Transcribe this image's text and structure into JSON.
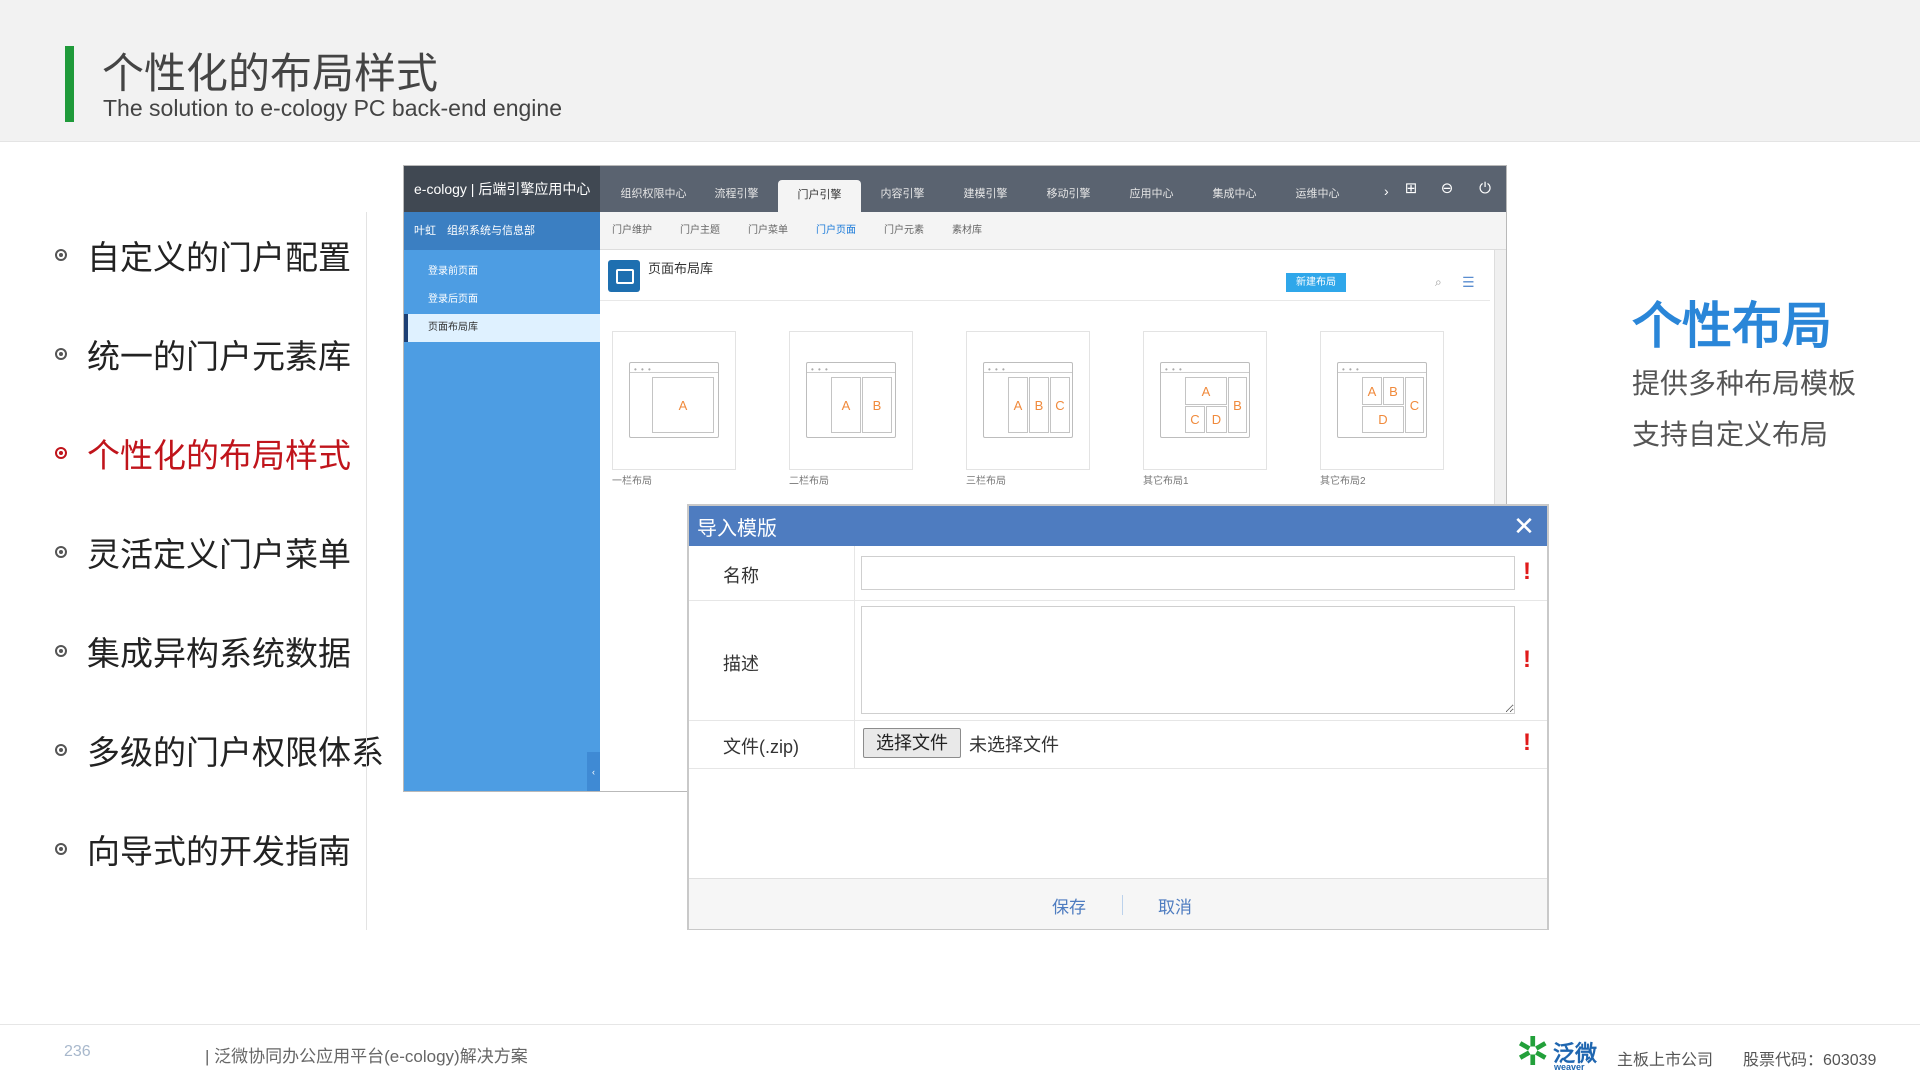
{
  "header": {
    "title": "个性化的布局样式",
    "subtitle": "The solution to e-cology PC back-end engine"
  },
  "features": [
    {
      "label": "自定义的门户配置",
      "active": false
    },
    {
      "label": "统一的门户元素库",
      "active": false
    },
    {
      "label": "个性化的布局样式",
      "active": true
    },
    {
      "label": "灵活定义门户菜单",
      "active": false
    },
    {
      "label": "集成异构系统数据",
      "active": false
    },
    {
      "label": "多级的门户权限体系",
      "active": false
    },
    {
      "label": "向导式的开发指南",
      "active": false
    }
  ],
  "app": {
    "brand": "e-cology | 后端引擎应用中心",
    "top_tabs": [
      "组织权限中心",
      "流程引擎",
      "门户引擎",
      "内容引擎",
      "建模引擎",
      "移动引擎",
      "应用中心",
      "集成中心",
      "运维中心"
    ],
    "top_active_index": 2,
    "sidebar": {
      "user": "叶虹　组织系统与信息部",
      "items": [
        "登录前页面",
        "登录后页面",
        "页面布局库"
      ],
      "active_index": 2
    },
    "sub_tabs": [
      "门户维护",
      "门户主题",
      "门户菜单",
      "门户页面",
      "门户元素",
      "素材库"
    ],
    "sub_active_index": 3,
    "section_title": "页面布局库",
    "new_button": "新建布局",
    "layouts": [
      {
        "name": "一栏布局",
        "panes": [
          "A"
        ]
      },
      {
        "name": "二栏布局",
        "panes": [
          "A",
          "B"
        ]
      },
      {
        "name": "三栏布局",
        "panes": [
          "A",
          "B",
          "C"
        ]
      },
      {
        "name": "其它布局1",
        "panes": [
          "A",
          "C",
          "D",
          "B"
        ]
      },
      {
        "name": "其它布局2",
        "panes": [
          "A",
          "B",
          "D",
          "C"
        ]
      }
    ]
  },
  "dialog": {
    "title": "导入模版",
    "fields": {
      "name_label": "名称",
      "desc_label": "描述",
      "file_label": "文件(.zip)",
      "file_button": "选择文件",
      "file_status": "未选择文件",
      "required_mark": "!"
    },
    "save": "保存",
    "cancel": "取消"
  },
  "side": {
    "heading": "个性布局",
    "lines": [
      "提供多种布局模板",
      "支持自定义布局"
    ]
  },
  "footer": {
    "page_number": "236",
    "text": "| 泛微协同办公应用平台(e-cology)解决方案",
    "logo_text": "泛微",
    "logo_sub": "weaver",
    "company": "主板上市公司",
    "stock": "股票代码：603039"
  },
  "colors": {
    "accent_green": "#1f9a3a",
    "active_red": "#c0141b",
    "heading_blue": "#2a86d8",
    "dialog_blue": "#4e7cc0",
    "sidebar_blue": "#4d9de3"
  }
}
